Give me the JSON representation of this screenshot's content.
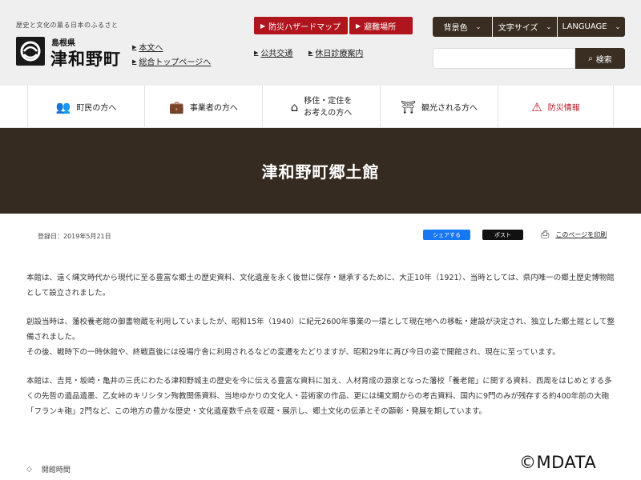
{
  "header": {
    "tagline": "歴史と文化の薫る日本のふるさと",
    "prefecture": "島根県",
    "town": "津和野町",
    "quick_links": [
      "本文へ",
      "総合トップページへ"
    ],
    "hazard_map": "防災ハザードマップ",
    "evacuation": "避難場所",
    "sub_links": [
      "公共交通",
      "休日診療案内"
    ],
    "bg_color_label": "背景色",
    "font_size_label": "文字サイズ",
    "language_label": "LANGUAGE",
    "search_placeholder": "",
    "search_label": "検索"
  },
  "nav": {
    "items": [
      {
        "label": "町民の方へ",
        "icon": "people-icon"
      },
      {
        "label": "事業者の方へ",
        "icon": "briefcase-icon"
      },
      {
        "label_line1": "移住・定住を",
        "label_line2": "お考えの方へ",
        "icon": "house-icon"
      },
      {
        "label": "観光される方へ",
        "icon": "torii-icon"
      },
      {
        "label": "防災情報",
        "icon": "warning-icon"
      }
    ]
  },
  "page": {
    "title": "津和野町郷土館",
    "registered": "登録日：2019年5月21日",
    "share_facebook": "シェアする",
    "share_x": "ポスト",
    "print_label": "このページを印刷"
  },
  "content": {
    "p1": "本館は、遠く縄文時代から現代に至る豊富な郷土の歴史資料、文化遺産を永く後世に保存・継承するために、大正10年（1921）、当時としては、県内唯一の郷土歴史博物館として設立されました。",
    "p2a": "創設当時は、藩校養老館の御書物蔵を利用していましたが、昭和15年（1940）に紀元2600年事業の一環として現在地への移転・建設が決定され、独立した郷土館として整備されました。",
    "p2b": "その後、戦時下の一時休館や、終戦直後には役場庁舎に利用されるなどの変遷をたどりますが、昭和29年に再び今日の姿で開館され、現在に至っています。",
    "p3": "本館は、吉見・坂崎・亀井の三氏にわたる津和野城主の歴史を今に伝える豊富な資料に加え、人材育成の源泉となった藩校「養老館」に関する資料、西周をはじめとする多くの先哲の遺品遺墨、乙女峠のキリシタン殉教関係資料、当地ゆかりの文化人・芸術家の作品、更には縄文期からの考古資料、国内に9門のみが残存する約400年前の大砲「フランキ砲」2門など、この地方の豊かな歴史・文化遺産数千点を収蔵・展示し、郷土文化の伝承とその顕彰・発展を期しています。",
    "section_heading": "開館時間"
  },
  "watermark": "©MDATA",
  "colors": {
    "accent_red": "#b0151e",
    "dark_brown": "#352b20",
    "header_bg": "#efefef"
  }
}
